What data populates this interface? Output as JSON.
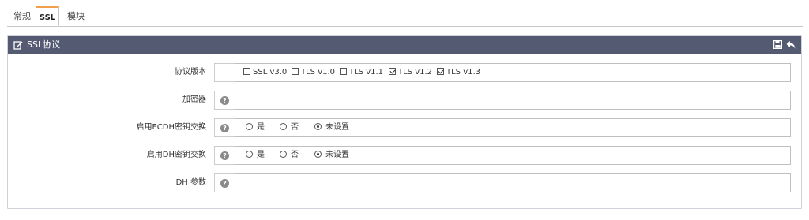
{
  "tabs": [
    {
      "label": "常规"
    },
    {
      "label": "SSL"
    },
    {
      "label": "模块"
    }
  ],
  "panel": {
    "title": "SSL协议"
  },
  "form": {
    "protocol_version": {
      "label": "协议版本",
      "options": [
        {
          "label": "SSL v3.0",
          "checked": false
        },
        {
          "label": "TLS v1.0",
          "checked": false
        },
        {
          "label": "TLS v1.1",
          "checked": false
        },
        {
          "label": "TLS v1.2",
          "checked": true
        },
        {
          "label": "TLS v1.3",
          "checked": true
        }
      ]
    },
    "cipher": {
      "label": "加密器",
      "value": ""
    },
    "ecdh": {
      "label": "启用ECDH密钥交换",
      "options": [
        {
          "label": "是",
          "checked": false
        },
        {
          "label": "否",
          "checked": false
        },
        {
          "label": "未设置",
          "checked": true
        }
      ]
    },
    "dh": {
      "label": "启用DH密钥交换",
      "options": [
        {
          "label": "是",
          "checked": false
        },
        {
          "label": "否",
          "checked": false
        },
        {
          "label": "未设置",
          "checked": true
        }
      ]
    },
    "dh_param": {
      "label": "DH 参数",
      "value": ""
    }
  },
  "colors": {
    "panel_header": "#545a72",
    "active_tab_accent": "#f0a04b"
  }
}
